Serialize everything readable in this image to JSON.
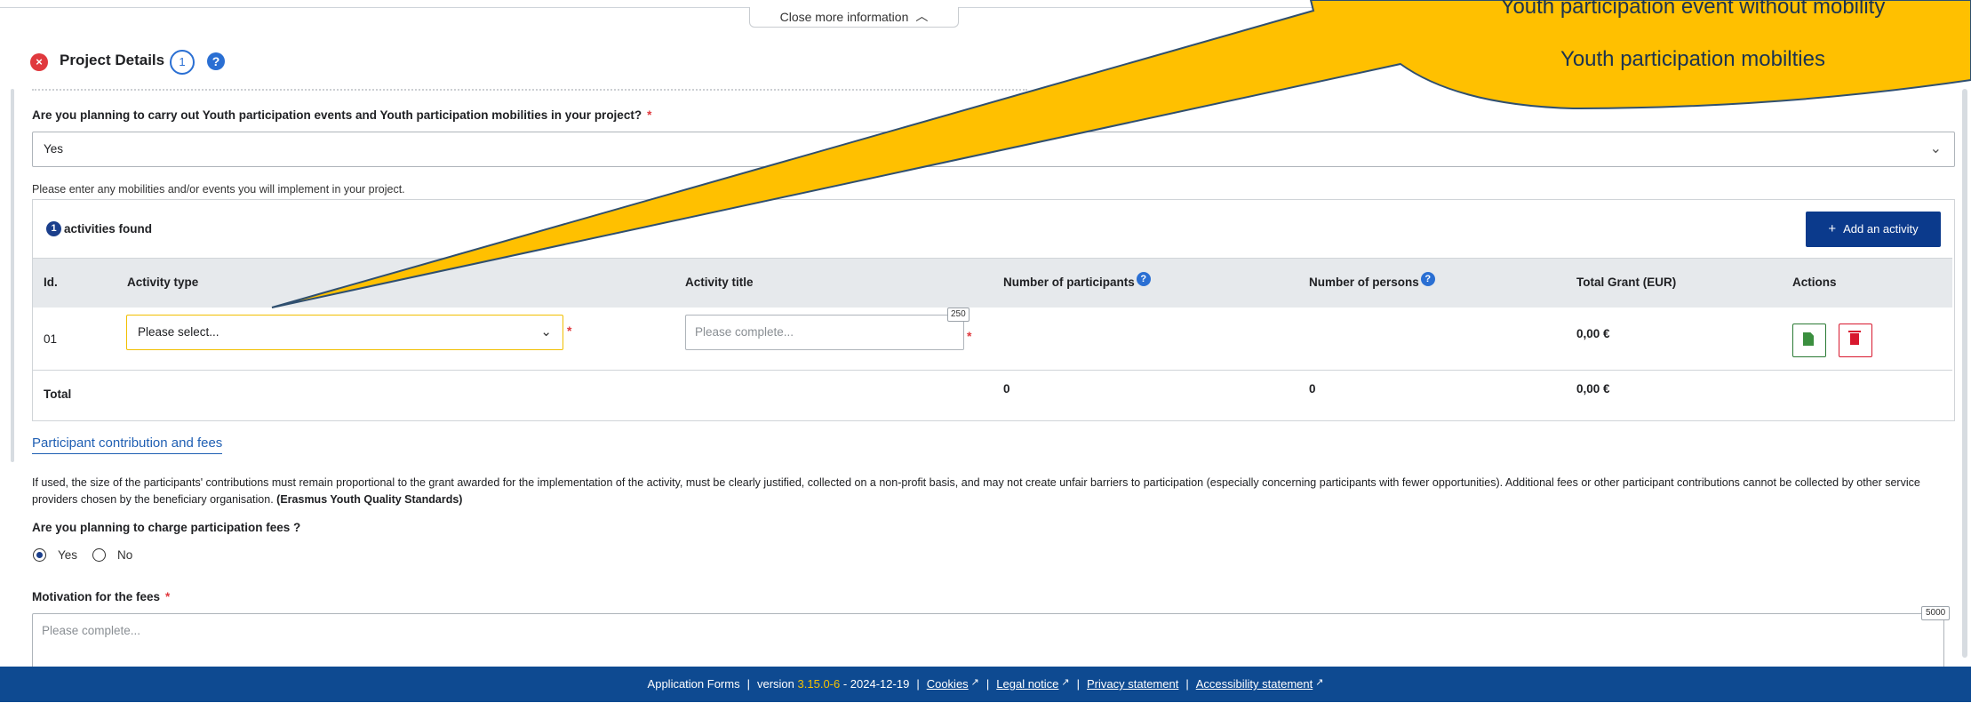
{
  "top_toggle": {
    "label": "Close more information"
  },
  "section": {
    "title": "Project Details",
    "count": "1",
    "status_icon": "error-x-icon",
    "help_icon": "help-question-icon"
  },
  "question_youth": {
    "label": "Are you planning to carry out Youth participation events and Youth participation mobilities in your project?",
    "required": "*",
    "value": "Yes"
  },
  "hint": "Please enter any mobilities and/or events you will implement in your project.",
  "activities": {
    "found_count": "1",
    "found_label": "activities found",
    "add_label": "Add an activity",
    "headers": {
      "id": "Id.",
      "type": "Activity type",
      "title": "Activity title",
      "participants": "Number of participants",
      "persons": "Number of persons",
      "grant": "Total Grant (EUR)",
      "actions": "Actions"
    },
    "rows": [
      {
        "id": "01",
        "type_value": "Please select...",
        "title_placeholder": "Please complete...",
        "title_maxlen": "250",
        "grant": "0,00 €"
      }
    ],
    "total": {
      "label": "Total",
      "participants": "0",
      "persons": "0",
      "grant": "0,00 €"
    }
  },
  "contribution": {
    "link": "Participant contribution and fees",
    "text": "If used, the size of the participants' contributions must remain proportional to the grant awarded for the implementation of the activity, must be clearly justified, collected on a non-profit basis, and may not create unfair barriers to participation (especially concerning participants with fewer opportunities). Additional fees or other participant contributions cannot be collected by other service providers chosen by the beneficiary organisation.",
    "text_bold": "(Erasmus Youth Quality Standards)",
    "fees_question": "Are you planning to charge participation fees ?",
    "options": [
      "Yes",
      "No"
    ],
    "selected": "Yes",
    "motivation_label": "Motivation for the fees",
    "motivation_required": "*",
    "motivation_placeholder": "Please complete...",
    "motivation_maxlen": "5000"
  },
  "footer": {
    "app": "Application Forms",
    "version_prefix": "version",
    "version": "3.15.0-6",
    "date": "- 2024-12-19",
    "cookies": "Cookies",
    "legal": "Legal notice",
    "privacy": "Privacy statement",
    "accessibility": "Accessibility statement"
  },
  "callout": {
    "line1": "Youth participation event without mobility",
    "line2": "Youth participation mobilties",
    "fill_color": "#FFC000",
    "stroke_color": "#2F4F6F"
  }
}
